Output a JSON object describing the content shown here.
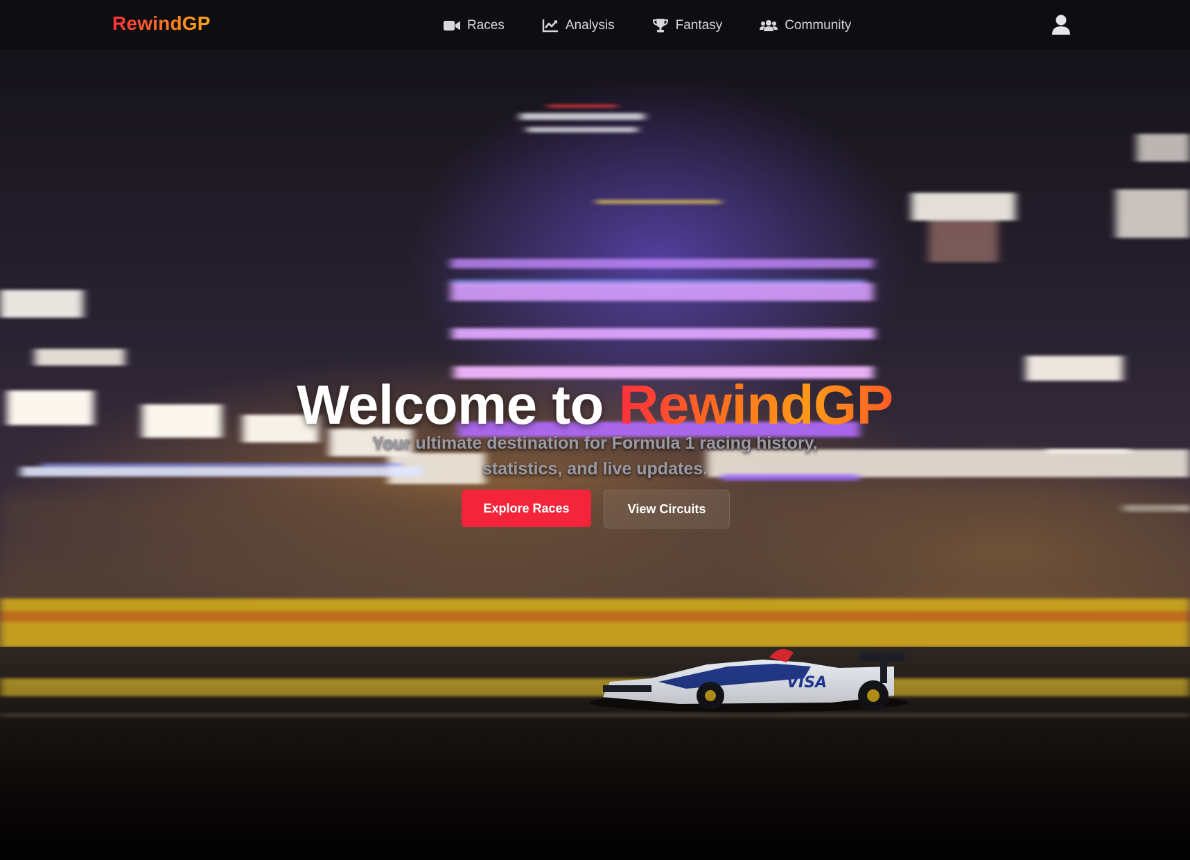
{
  "brand": {
    "name": "RewindGP"
  },
  "nav": {
    "items": [
      {
        "label": "Races",
        "icon": "video-camera-icon"
      },
      {
        "label": "Analysis",
        "icon": "line-chart-icon"
      },
      {
        "label": "Fantasy",
        "icon": "trophy-icon"
      },
      {
        "label": "Community",
        "icon": "users-icon"
      }
    ],
    "account_icon": "user-icon"
  },
  "hero": {
    "title_prefix": "Welcome to",
    "title_accent": "RewindGP",
    "subtitle": "Your ultimate destination for Formula 1 racing history, statistics, and live updates.",
    "primary_button": "Explore Races",
    "secondary_button": "View Circuits",
    "background": "blurred night race with Formula 1 car"
  },
  "colors": {
    "accent_red": "#f4253a",
    "accent_orange": "#ff9a1a",
    "navbar_bg": "#0e0e10"
  }
}
